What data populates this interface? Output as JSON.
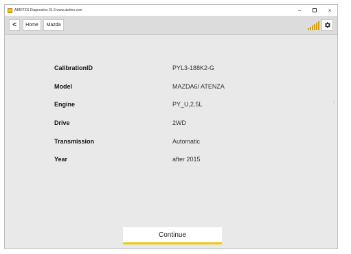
{
  "window": {
    "title": "ABRITES Diagnostics 31.9   www.abrites.com",
    "min_glyph": "−",
    "close_glyph": "×"
  },
  "toolbar": {
    "back_glyph": "<",
    "home_label": "Home",
    "mazda_label": "Mazda",
    "signal_color": "#d4a017"
  },
  "details": [
    {
      "label": "CalibrationID",
      "value": "PYL3-188K2-G"
    },
    {
      "label": "Model",
      "value": "MAZDA6/ ATENZA"
    },
    {
      "label": "Engine",
      "value": "PY_U,2.5L"
    },
    {
      "label": "Drive",
      "value": "2WD"
    },
    {
      "label": "Transmission",
      "value": "Automatic"
    },
    {
      "label": "Year",
      "value": "after 2015"
    }
  ],
  "continue_label": "Continue",
  "accent_color": "#f0c800"
}
